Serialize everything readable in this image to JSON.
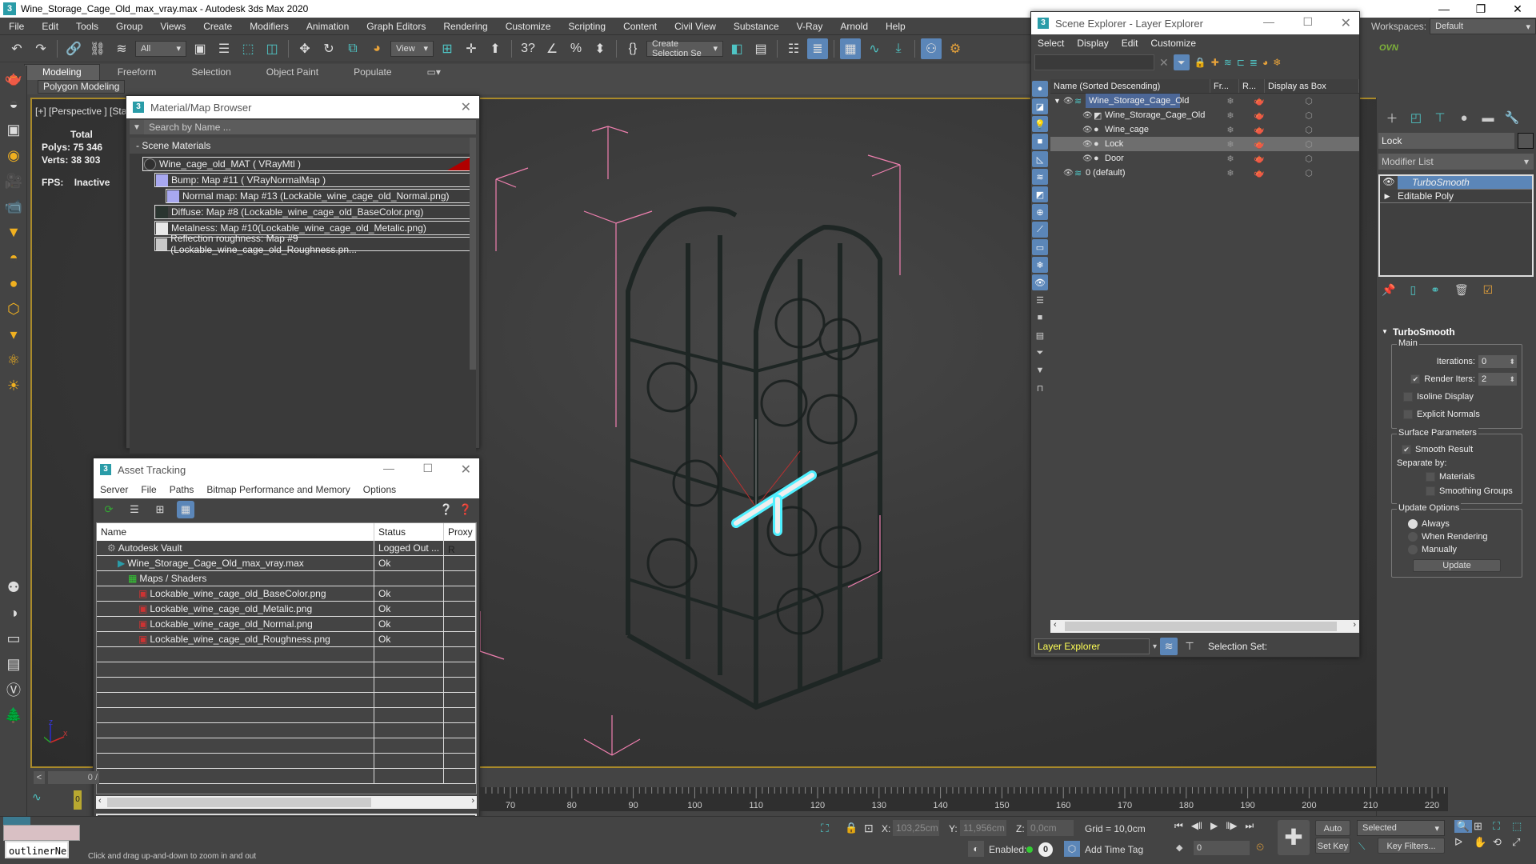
{
  "app": {
    "title": "Wine_Storage_Cage_Old_max_vray.max - Autodesk 3ds Max 2020",
    "workspaces_label": "Workspaces:",
    "workspace": "Default",
    "ovn_label": "OVN"
  },
  "menu": [
    "File",
    "Edit",
    "Tools",
    "Group",
    "Views",
    "Create",
    "Modifiers",
    "Animation",
    "Graph Editors",
    "Rendering",
    "Customize",
    "Scripting",
    "Content",
    "Civil View",
    "Substance",
    "V-Ray",
    "Arnold",
    "Help"
  ],
  "toolbar": {
    "filter_value": "All",
    "refcoord_value": "View",
    "selection_set_value": "Create Selection Se"
  },
  "ribbon": {
    "tabs": [
      "Modeling",
      "Freeform",
      "Selection",
      "Object Paint",
      "Populate"
    ],
    "active_tab": "Modeling",
    "panel_button": "Polygon Modeling"
  },
  "viewport": {
    "label": "[+] [Perspective ] [Star",
    "stats_total_label": "Total",
    "polys_label": "Polys:",
    "polys_value": "75 346",
    "verts_label": "Verts:",
    "verts_value": "38 303",
    "fps_label": "FPS:",
    "fps_value": "Inactive",
    "axis": {
      "x": "X",
      "y": "Y",
      "z": "Z"
    }
  },
  "material_browser": {
    "title": "Material/Map Browser",
    "search_placeholder": "Search by Name ...",
    "category": "- Scene Materials",
    "items": [
      {
        "label": "Wine_cage_old_MAT  ( VRayMtl )",
        "swatch": "#303030"
      },
      {
        "label": "Bump: Map #11  ( VRayNormalMap )",
        "swatch": "#a8a8f0"
      },
      {
        "label": "Normal map: Map #13 (Lockable_wine_cage_old_Normal.png)",
        "swatch": "#a8a8f0"
      },
      {
        "label": "Diffuse: Map #8 (Lockable_wine_cage_old_BaseColor.png)",
        "swatch": "#2a3530"
      },
      {
        "label": "Metalness: Map #10(Lockable_wine_cage_old_Metalic.png)",
        "swatch": "#e8e8e8"
      },
      {
        "label": "Reflection roughness: Map #9 (Lockable_wine_cage_old_Roughness.pn...",
        "swatch": "#c8c8c8"
      }
    ]
  },
  "asset_tracking": {
    "title": "Asset Tracking",
    "menu": [
      "Server",
      "File",
      "Paths",
      "Bitmap Performance and Memory",
      "Options"
    ],
    "columns": [
      "Name",
      "Status",
      "Proxy R"
    ],
    "rows": [
      {
        "name": "Autodesk Vault",
        "status": "Logged Out ...",
        "icon": "vault-icon",
        "indent": 1
      },
      {
        "name": "Wine_Storage_Cage_Old_max_vray.max",
        "status": "Ok",
        "icon": "max-file-icon",
        "indent": 2
      },
      {
        "name": "Maps / Shaders",
        "status": "",
        "icon": "maps-icon",
        "indent": 3
      },
      {
        "name": "Lockable_wine_cage_old_BaseColor.png",
        "status": "Ok",
        "icon": "png-icon",
        "indent": 4
      },
      {
        "name": "Lockable_wine_cage_old_Metalic.png",
        "status": "Ok",
        "icon": "png-icon",
        "indent": 4
      },
      {
        "name": "Lockable_wine_cage_old_Normal.png",
        "status": "Ok",
        "icon": "png-icon",
        "indent": 4
      },
      {
        "name": "Lockable_wine_cage_old_Roughness.png",
        "status": "Ok",
        "icon": "png-icon",
        "indent": 4
      }
    ]
  },
  "scene_explorer": {
    "title": "Scene Explorer - Layer Explorer",
    "menu": [
      "Select",
      "Display",
      "Edit",
      "Customize"
    ],
    "columns": [
      "Name (Sorted Descending)",
      "Fr...",
      "R...",
      "Display as Box"
    ],
    "rows": [
      {
        "name": "Wine_Storage_Cage_Old",
        "type": "layer",
        "level": 0,
        "selected": false,
        "parent": true
      },
      {
        "name": "Wine_Storage_Cage_Old",
        "type": "group",
        "level": 1,
        "selected": false
      },
      {
        "name": "Wine_cage",
        "type": "object",
        "level": 1,
        "selected": false
      },
      {
        "name": "Lock",
        "type": "object",
        "level": 1,
        "selected": true
      },
      {
        "name": "Door",
        "type": "object",
        "level": 1,
        "selected": false
      },
      {
        "name": "0 (default)",
        "type": "layer",
        "level": 0,
        "selected": false
      }
    ],
    "explorer_mode": "Layer Explorer",
    "selection_set_label": "Selection Set:"
  },
  "command_panel": {
    "object_name": "Lock",
    "modifier_list_label": "Modifier List",
    "stack": [
      {
        "label": "TurboSmooth",
        "selected": true
      },
      {
        "label": "Editable Poly",
        "selected": false
      }
    ],
    "rollout_title": "TurboSmooth",
    "main_group": "Main",
    "iterations_label": "Iterations:",
    "iterations_value": "0",
    "render_iters_label": "Render Iters:",
    "render_iters_value": "2",
    "render_iters_checked": true,
    "isoline_label": "Isoline Display",
    "isoline_checked": false,
    "explicit_normals_label": "Explicit Normals",
    "explicit_normals_checked": false,
    "surface_group": "Surface Parameters",
    "smooth_result_label": "Smooth Result",
    "smooth_result_checked": true,
    "separate_by_label": "Separate by:",
    "materials_label": "Materials",
    "smoothing_groups_label": "Smoothing Groups",
    "update_group": "Update Options",
    "update_options": [
      "Always",
      "When Rendering",
      "Manually"
    ],
    "update_selected": "Always",
    "update_button": "Update"
  },
  "timeline": {
    "frame_display": "0 /",
    "current_frame": "0",
    "ticks": [
      70,
      80,
      90,
      100,
      110,
      120,
      130,
      140,
      150,
      160,
      170,
      180,
      190,
      200,
      210,
      220
    ]
  },
  "statusbar": {
    "x_label": "X:",
    "x_value": "103,25cm",
    "y_label": "Y:",
    "y_value": "11,956cm",
    "z_label": "Z:",
    "z_value": "0,0cm",
    "grid": "Grid = 10,0cm",
    "enabled_label": "Enabled:",
    "enabled_count": "0",
    "add_time_tag": "Add Time Tag",
    "auto_key": "Auto Key",
    "set_key": "Set Key",
    "key_mode": "Selected",
    "key_filters": "Key Filters...",
    "frame_field": "0",
    "prompt": "Click and drag up-and-down to zoom in and out",
    "script_listener": "outlinerNest"
  }
}
